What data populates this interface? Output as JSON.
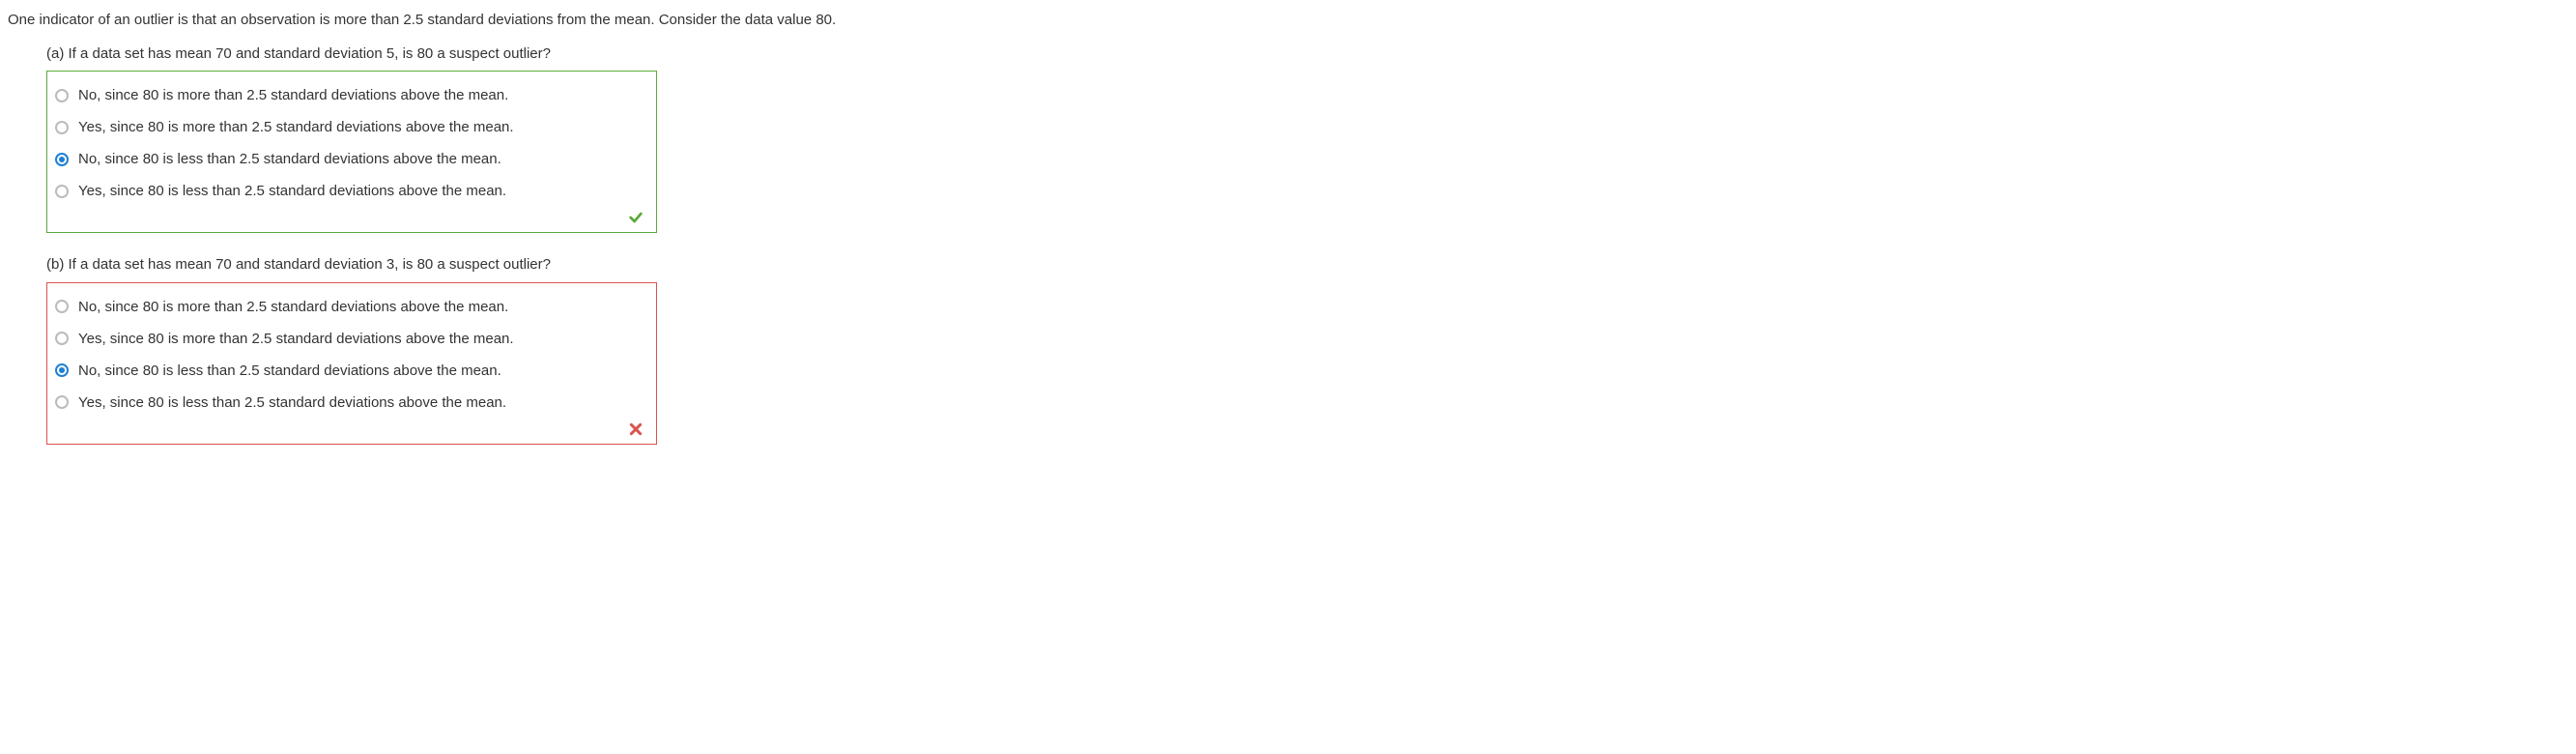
{
  "intro": "One indicator of an outlier is that an observation is more than 2.5 standard deviations from the mean. Consider the data value 80.",
  "parts": {
    "a": {
      "label": "(a) If a data set has mean 70 and standard deviation 5, is 80 a suspect outlier?",
      "options": [
        "No, since 80 is more than 2.5 standard deviations above the mean.",
        "Yes, since 80 is more than 2.5 standard deviations above the mean.",
        "No, since 80 is less than 2.5 standard deviations above the mean.",
        "Yes, since 80 is less than 2.5 standard deviations above the mean."
      ],
      "selected_index": 2,
      "result": "correct"
    },
    "b": {
      "label": "(b) If a data set has mean 70 and standard deviation 3, is 80 a suspect outlier?",
      "options": [
        "No, since 80 is more than 2.5 standard deviations above the mean.",
        "Yes, since 80 is more than 2.5 standard deviations above the mean.",
        "No, since 80 is less than 2.5 standard deviations above the mean.",
        "Yes, since 80 is less than 2.5 standard deviations above the mean."
      ],
      "selected_index": 2,
      "result": "incorrect"
    }
  }
}
